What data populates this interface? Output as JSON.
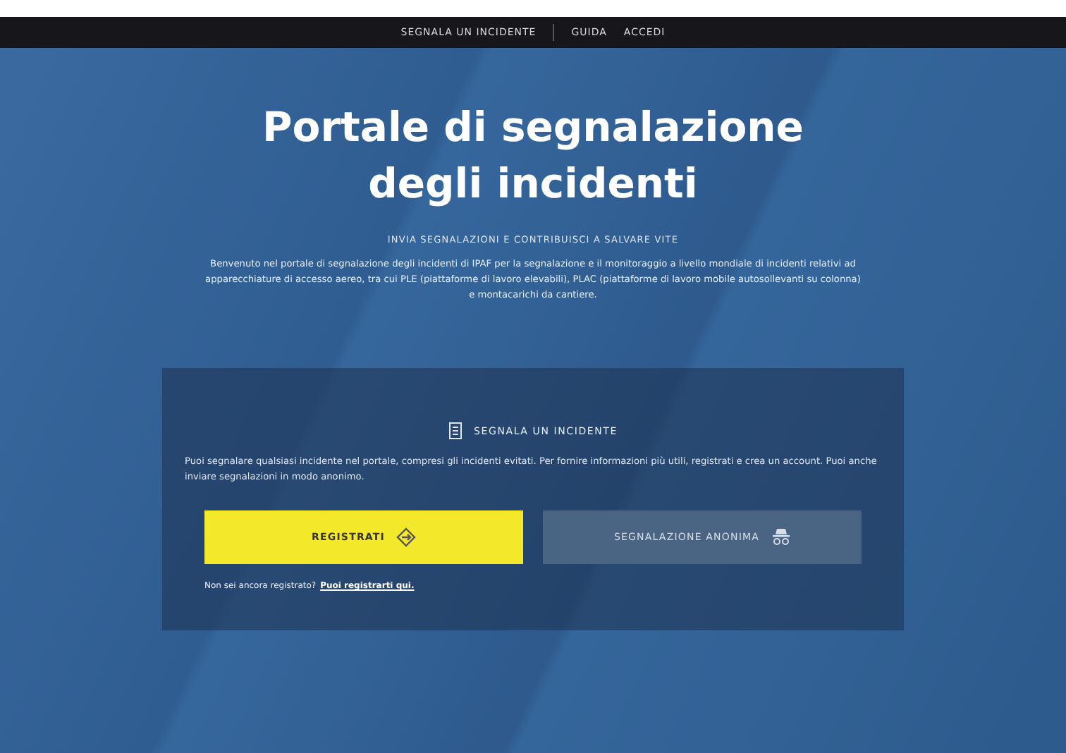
{
  "nav": {
    "items": [
      {
        "label": "SEGNALA UN INCIDENTE"
      },
      {
        "label": "GUIDA"
      },
      {
        "label": "ACCEDI"
      }
    ]
  },
  "hero": {
    "title": "Portale di segnalazione degli incidenti",
    "subtitle": "INVIA SEGNALAZIONI E CONTRIBUISCI A SALVARE VITE",
    "intro": "Benvenuto nel portale di segnalazione degli incidenti di IPAF per la segnalazione e il monitoraggio a livello mondiale di incidenti relativi ad apparecchiature di accesso aereo, tra cui PLE (piattaforme di lavoro elevabili), PLAC (piattaforme di lavoro mobile autosollevanti su colonna) e montacarichi da cantiere."
  },
  "card": {
    "heading": "SEGNALA UN INCIDENTE",
    "text": "Puoi segnalare qualsiasi incidente nel portale, compresi gli incidenti evitati. Per fornire informazioni più utili, registrati e crea un account. Puoi anche inviare segnalazioni in modo anonimo.",
    "buttons": [
      {
        "label": "REGISTRATI",
        "kind": "primary"
      },
      {
        "label": "SEGNALAZIONE ANONIMA",
        "kind": "secondary"
      }
    ],
    "footer": {
      "text": "Non sei ancora registrato?",
      "link": "Puoi registrarti qui."
    }
  }
}
